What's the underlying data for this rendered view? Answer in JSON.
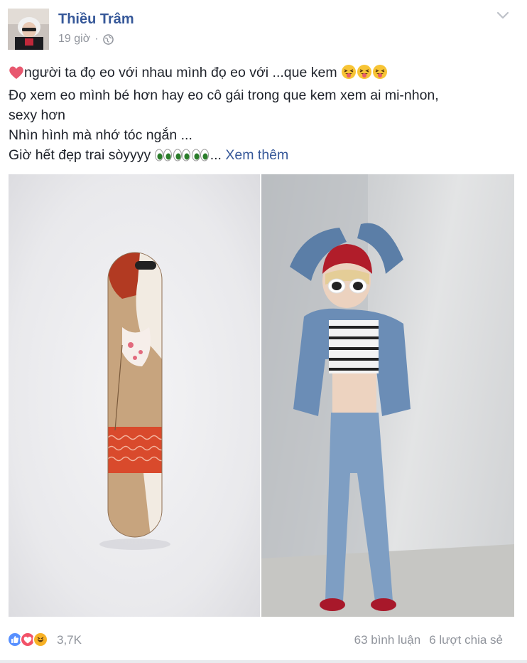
{
  "post": {
    "author": "Thiều Trâm",
    "time": "19 giờ",
    "time_separator": "·",
    "privacy_icon": "globe-icon",
    "options_icon": "chevron-down-icon",
    "lines": [
      "người ta đọ eo với nhau mình đọ eo với ...que kem",
      "Đọ xem eo mình bé hơn hay eo cô gái trong que kem xem ai mi-nhon,",
      "sexy hơn",
      "Nhìn hình mà nhớ tóc ngắn ...",
      "Giờ hết đẹp trai sòyyyy"
    ],
    "ellipsis": "...",
    "see_more": "Xem thêm",
    "emojis": [
      "heart-icon",
      "tongue-wink-emoji",
      "eyes-emoji"
    ]
  },
  "photos": [
    {
      "subject": "ice-cream-stick-illustration"
    },
    {
      "subject": "woman-posing-photo"
    }
  ],
  "footer": {
    "reactions": [
      "like-icon",
      "love-icon",
      "haha-icon"
    ],
    "reaction_count": "3,7K",
    "comments": "63 bình luận",
    "shares": "6 lượt chia sẻ"
  },
  "colors": {
    "link": "#365899",
    "meta": "#90949c",
    "text": "#1d2129",
    "like": "#5890ff",
    "love": "#f25268",
    "haha": "#f7b125"
  }
}
